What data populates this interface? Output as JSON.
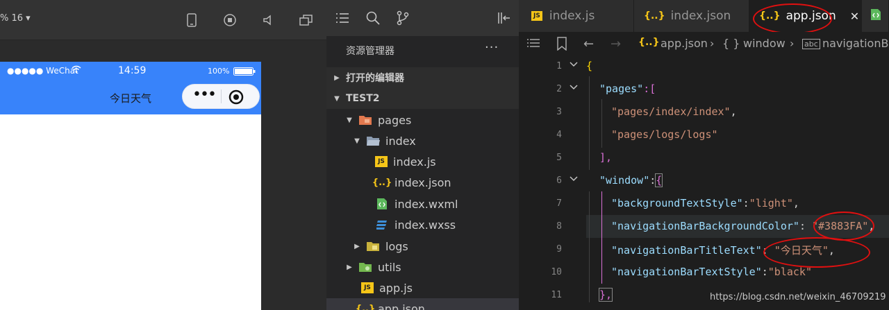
{
  "simulator": {
    "zoom_label": "% 16 ▾",
    "status": {
      "signal": "●●●●● WeChat",
      "time": "14:59",
      "battery": "100%"
    },
    "nav_title": "今日天气",
    "nav_color": "#3883FA",
    "capsule_dots": "•••"
  },
  "explorer": {
    "title": "资源管理器",
    "more": "···",
    "sections": {
      "open_editors": "打开的编辑器",
      "project": "TEST2"
    },
    "tree": [
      {
        "label": "pages",
        "icon": "folder-icon"
      },
      {
        "label": "index",
        "icon": "folder-open-icon"
      },
      {
        "label": "index.js",
        "icon": "js-file-icon"
      },
      {
        "label": "index.json",
        "icon": "json-file-icon"
      },
      {
        "label": "index.wxml",
        "icon": "wxml-file-icon"
      },
      {
        "label": "index.wxss",
        "icon": "wxss-file-icon"
      },
      {
        "label": "logs",
        "icon": "folder-icon"
      },
      {
        "label": "utils",
        "icon": "folder-icon"
      },
      {
        "label": "app.js",
        "icon": "js-file-icon"
      },
      {
        "label": "app.json",
        "icon": "json-file-icon"
      }
    ]
  },
  "editor": {
    "tabs": [
      {
        "label": "index.js",
        "icon_text": "JS"
      },
      {
        "label": "index.json",
        "icon_text": "{..}"
      },
      {
        "label": "app.json",
        "icon_text": "{..}",
        "close": "✕"
      }
    ],
    "breadcrumb": {
      "icon_text": "{..}",
      "file": "app.json",
      "sep": "›",
      "obj_icon": "{ }",
      "obj": "window",
      "prop_icon": "abc",
      "prop": "navigationBa"
    },
    "line_numbers": [
      "1",
      "2",
      "3",
      "4",
      "5",
      "6",
      "7",
      "8",
      "9",
      "10",
      "11"
    ],
    "code": {
      "l1_brace": "{",
      "l2_key": "\"pages\"",
      "l2_rest": ":[",
      "l3": "\"pages/index/index\"",
      "l3_comma": ",",
      "l4": "\"pages/logs/logs\"",
      "l5": "],",
      "l6_key": "\"window\"",
      "l6_colon": ":",
      "l6_brace": "{",
      "l7_key": "\"backgroundTextStyle\"",
      "l7_colon": ":",
      "l7_val": "\"light\"",
      "l7_comma": ",",
      "l8_key": "\"navigationBarBackgroundColor\"",
      "l8_colon": ": ",
      "l8_val": "\"#3883FA\"",
      "l8_comma": ",",
      "l9_key": "\"navigationBarTitleText\"",
      "l9_colon": ": ",
      "l9_val": "\"今日天气\"",
      "l9_comma": ",",
      "l10_key": "\"navigationBarTextStyle\"",
      "l10_colon": ":",
      "l10_val": "\"black\"",
      "l11": "},"
    }
  },
  "watermark": "https://blog.csdn.net/weixin_46709219"
}
